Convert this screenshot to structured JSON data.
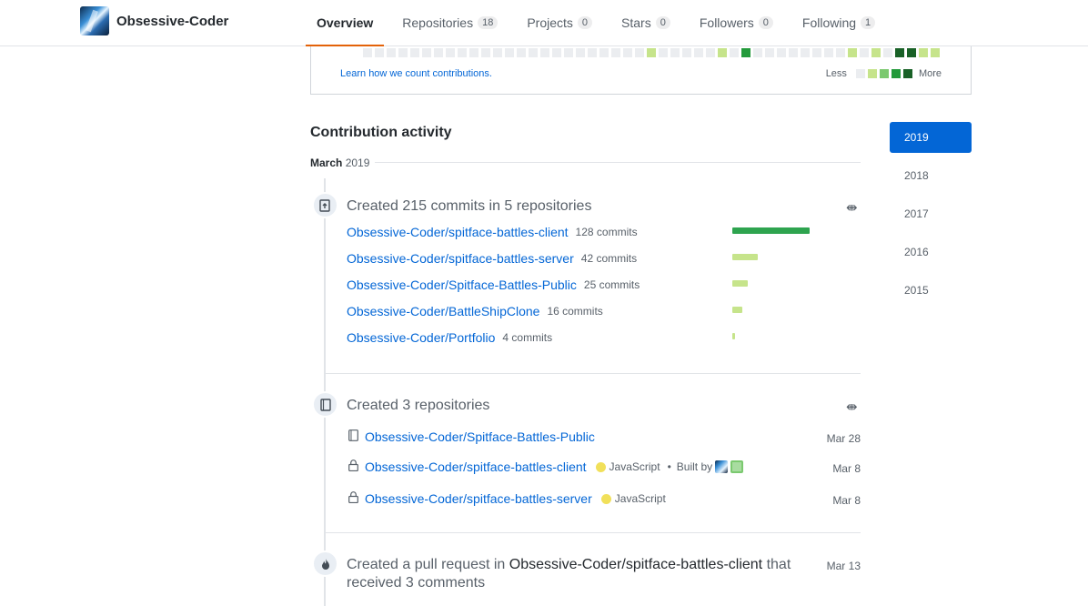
{
  "header": {
    "username": "Obsessive-Coder",
    "tabs": [
      {
        "label": "Overview",
        "count": null
      },
      {
        "label": "Repositories",
        "count": "18"
      },
      {
        "label": "Projects",
        "count": "0"
      },
      {
        "label": "Stars",
        "count": "0"
      },
      {
        "label": "Followers",
        "count": "0"
      },
      {
        "label": "Following",
        "count": "1"
      }
    ]
  },
  "calendar": {
    "learn_link": "Learn how we count contributions.",
    "legend_less": "Less",
    "legend_more": "More",
    "legend_colors": [
      "#ebedf0",
      "#c6e48b",
      "#7bc96f",
      "#239a3b",
      "#196127"
    ],
    "cell_levels": [
      0,
      0,
      0,
      0,
      0,
      0,
      0,
      0,
      0,
      0,
      0,
      0,
      0,
      0,
      0,
      0,
      0,
      0,
      0,
      0,
      0,
      0,
      0,
      0,
      1,
      0,
      0,
      0,
      0,
      0,
      1,
      0,
      3,
      0,
      0,
      0,
      0,
      0,
      0,
      0,
      0,
      1,
      0,
      1,
      0,
      4,
      4,
      1,
      1
    ]
  },
  "activity": {
    "title": "Contribution activity",
    "month": "March",
    "year": "2019",
    "commits_event": {
      "title": "Created 215 commits in 5 repositories",
      "rows": [
        {
          "repo": "Obsessive-Coder/spitface-battles-client",
          "count": "128 commits",
          "value": 128,
          "color": "#2ea44f"
        },
        {
          "repo": "Obsessive-Coder/spitface-battles-server",
          "count": "42 commits",
          "value": 42,
          "color": "#c6e48b"
        },
        {
          "repo": "Obsessive-Coder/Spitface-Battles-Public",
          "count": "25 commits",
          "value": 25,
          "color": "#c6e48b"
        },
        {
          "repo": "Obsessive-Coder/BattleShipClone",
          "count": "16 commits",
          "value": 16,
          "color": "#c6e48b"
        },
        {
          "repo": "Obsessive-Coder/Portfolio",
          "count": "4 commits",
          "value": 4,
          "color": "#c6e48b"
        }
      ]
    },
    "repos_event": {
      "title": "Created 3 repositories",
      "rows": [
        {
          "repo": "Obsessive-Coder/Spitface-Battles-Public",
          "language": "",
          "built_by": "",
          "date": "Mar 28",
          "private": false
        },
        {
          "repo": "Obsessive-Coder/spitface-battles-client",
          "language": "JavaScript",
          "built_by": "Built by",
          "date": "Mar 8",
          "private": true
        },
        {
          "repo": "Obsessive-Coder/spitface-battles-server",
          "language": "JavaScript",
          "built_by": "",
          "date": "Mar 8",
          "private": true
        }
      ]
    },
    "pr_event": {
      "prefix": "Created a pull request in",
      "repo": "Obsessive-Coder/spitface-battles-client",
      "suffix_line1": "that",
      "suffix_line2": "received 3 comments",
      "date": "Mar 13"
    }
  },
  "years": [
    "2019",
    "2018",
    "2017",
    "2016",
    "2015"
  ],
  "selected_year": "2019"
}
